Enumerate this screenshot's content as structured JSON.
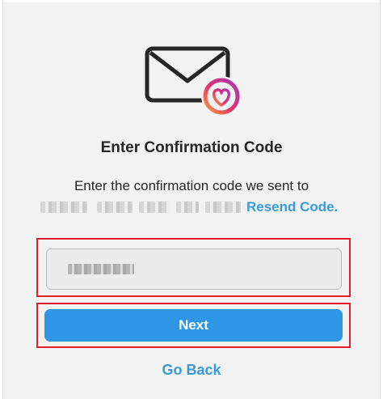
{
  "icons": {
    "envelope": "envelope-icon",
    "heart_badge": "heart-badge-icon"
  },
  "colors": {
    "accent_blue": "#2f96e6",
    "link_blue": "#3a9ad9",
    "highlight_red": "#e0202a",
    "text_dark": "#262626"
  },
  "header": {
    "title": "Enter Confirmation Code"
  },
  "body": {
    "instruction": "Enter the confirmation code we sent to",
    "resend_label": "Resend Code."
  },
  "form": {
    "code_value": ""
  },
  "actions": {
    "next_label": "Next",
    "go_back_label": "Go Back"
  }
}
